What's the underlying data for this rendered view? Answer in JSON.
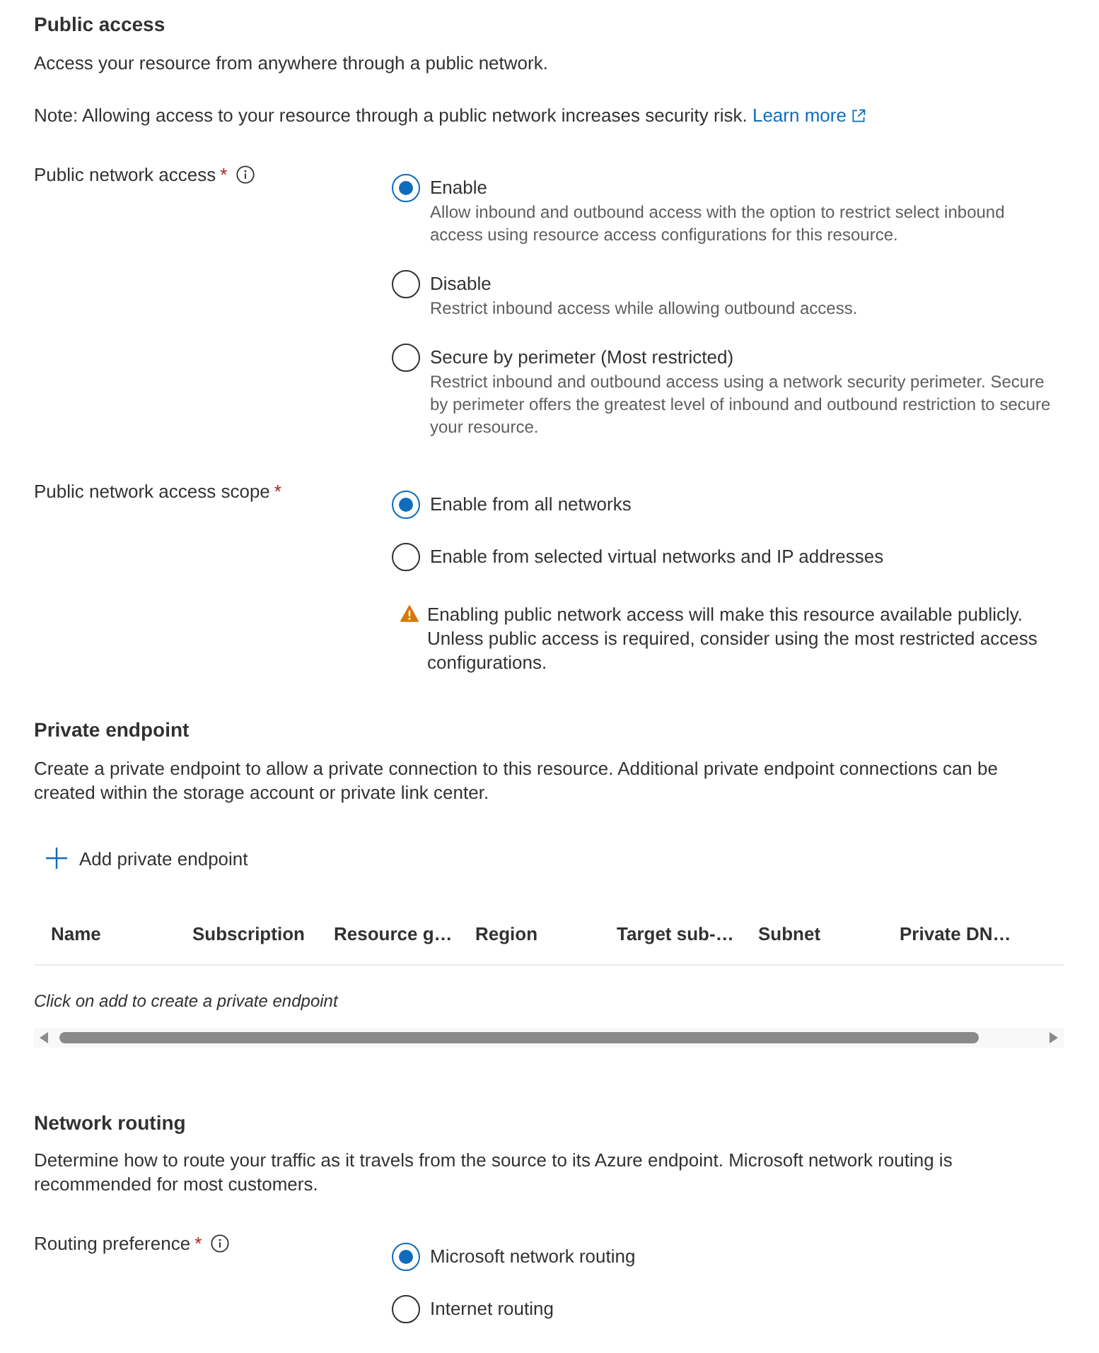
{
  "public_access": {
    "title": "Public access",
    "description": "Access your resource from anywhere through a public network.",
    "note": {
      "text": "Note: Allowing access to your resource through a public network increases security risk.",
      "link": "Learn more"
    },
    "fields": [
      {
        "label": "Public network access",
        "required_mark": "*",
        "has_info": true,
        "options": [
          {
            "label": "Enable",
            "description": "Allow inbound and outbound access with the option to restrict select inbound access using resource access configurations for this resource.",
            "selected": true
          },
          {
            "label": "Disable",
            "description": "Restrict inbound access while allowing outbound access.",
            "selected": false
          },
          {
            "label": "Secure by perimeter (Most restricted)",
            "description": "Restrict inbound and outbound access using a network security perimeter. Secure by perimeter offers the greatest level of inbound and outbound restriction to secure your resource.",
            "selected": false
          }
        ]
      },
      {
        "label": "Public network access scope",
        "required_mark": "*",
        "has_info": false,
        "options": [
          {
            "label": "Enable from all networks",
            "selected": true
          },
          {
            "label": "Enable from selected virtual networks and IP addresses",
            "selected": false
          }
        ],
        "warning": "Enabling public network access will make this resource available publicly. Unless public access is required, consider using the most restricted access configurations."
      }
    ]
  },
  "private_endpoint": {
    "title": "Private endpoint",
    "description": "Create a private endpoint to allow a private connection to this resource. Additional private endpoint connections can be created within the storage account or private link center.",
    "add_button": "Add private endpoint",
    "table": {
      "columns": [
        "Name",
        "Subscription",
        "Resource g…",
        "Region",
        "Target sub-…",
        "Subnet",
        "Private DN…"
      ],
      "empty_text": "Click on add to create a private endpoint"
    }
  },
  "network_routing": {
    "title": "Network routing",
    "description": "Determine how to route your traffic as it travels from the source to its Azure endpoint. Microsoft network routing is recommended for most customers.",
    "fields": [
      {
        "label": "Routing preference",
        "required_mark": "*",
        "has_info": true,
        "options": [
          {
            "label": "Microsoft network routing",
            "selected": true
          },
          {
            "label": "Internet routing",
            "selected": false
          }
        ]
      }
    ]
  }
}
